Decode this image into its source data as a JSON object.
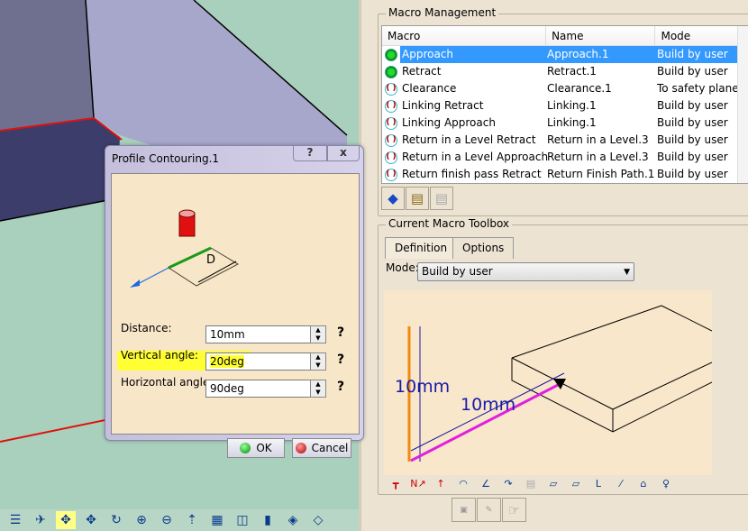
{
  "dialog": {
    "title": "Profile Contouring.1",
    "help_label": "?",
    "close_label": "x",
    "diagram_label": "D",
    "fields": [
      {
        "label": "Distance:",
        "value": "10mm",
        "highlighted": false
      },
      {
        "label": "Vertical angle:",
        "value": "20deg",
        "highlighted": true
      },
      {
        "label": "Horizontal angle:",
        "value": "90deg",
        "highlighted": false
      }
    ],
    "field_help": "?",
    "ok_label": "OK",
    "cancel_label": "Cancel"
  },
  "macro_management": {
    "title": "Macro Management",
    "columns": [
      "Macro",
      "Name",
      "Mode"
    ],
    "rows": [
      {
        "macro": "Approach",
        "name": "Approach.1",
        "mode": "Build by user",
        "active": true,
        "selected": true
      },
      {
        "macro": "Retract",
        "name": "Retract.1",
        "mode": "Build by user",
        "active": true,
        "selected": false
      },
      {
        "macro": "Clearance",
        "name": "Clearance.1",
        "mode": "To safety plane",
        "active": false,
        "selected": false
      },
      {
        "macro": "Linking Retract",
        "name": "Linking.1",
        "mode": "Build by user",
        "active": false,
        "selected": false
      },
      {
        "macro": "Linking Approach",
        "name": "Linking.1",
        "mode": "Build by user",
        "active": false,
        "selected": false
      },
      {
        "macro": "Return in a Level Retract",
        "name": "Return in a Level.3",
        "mode": "Build by user",
        "active": false,
        "selected": false
      },
      {
        "macro": "Return in a Level Approach",
        "name": "Return in a Level.3",
        "mode": "Build by user",
        "active": false,
        "selected": false
      },
      {
        "macro": "Return finish pass Retract",
        "name": "Return Finish Path.1",
        "mode": "Build by user",
        "active": false,
        "selected": false
      }
    ]
  },
  "toolbox": {
    "title": "Current Macro Toolbox",
    "tabs": [
      "Definition",
      "Options"
    ],
    "active_tab": "Definition",
    "mode_label": "Mode:",
    "mode_value": "Build by user",
    "diagram_labels": [
      "10mm",
      "10mm"
    ]
  },
  "colors": {
    "selection": "#3399ff",
    "highlight": "#ffff33",
    "viewport": "#a9d0bc",
    "panel": "#ece3d3"
  }
}
